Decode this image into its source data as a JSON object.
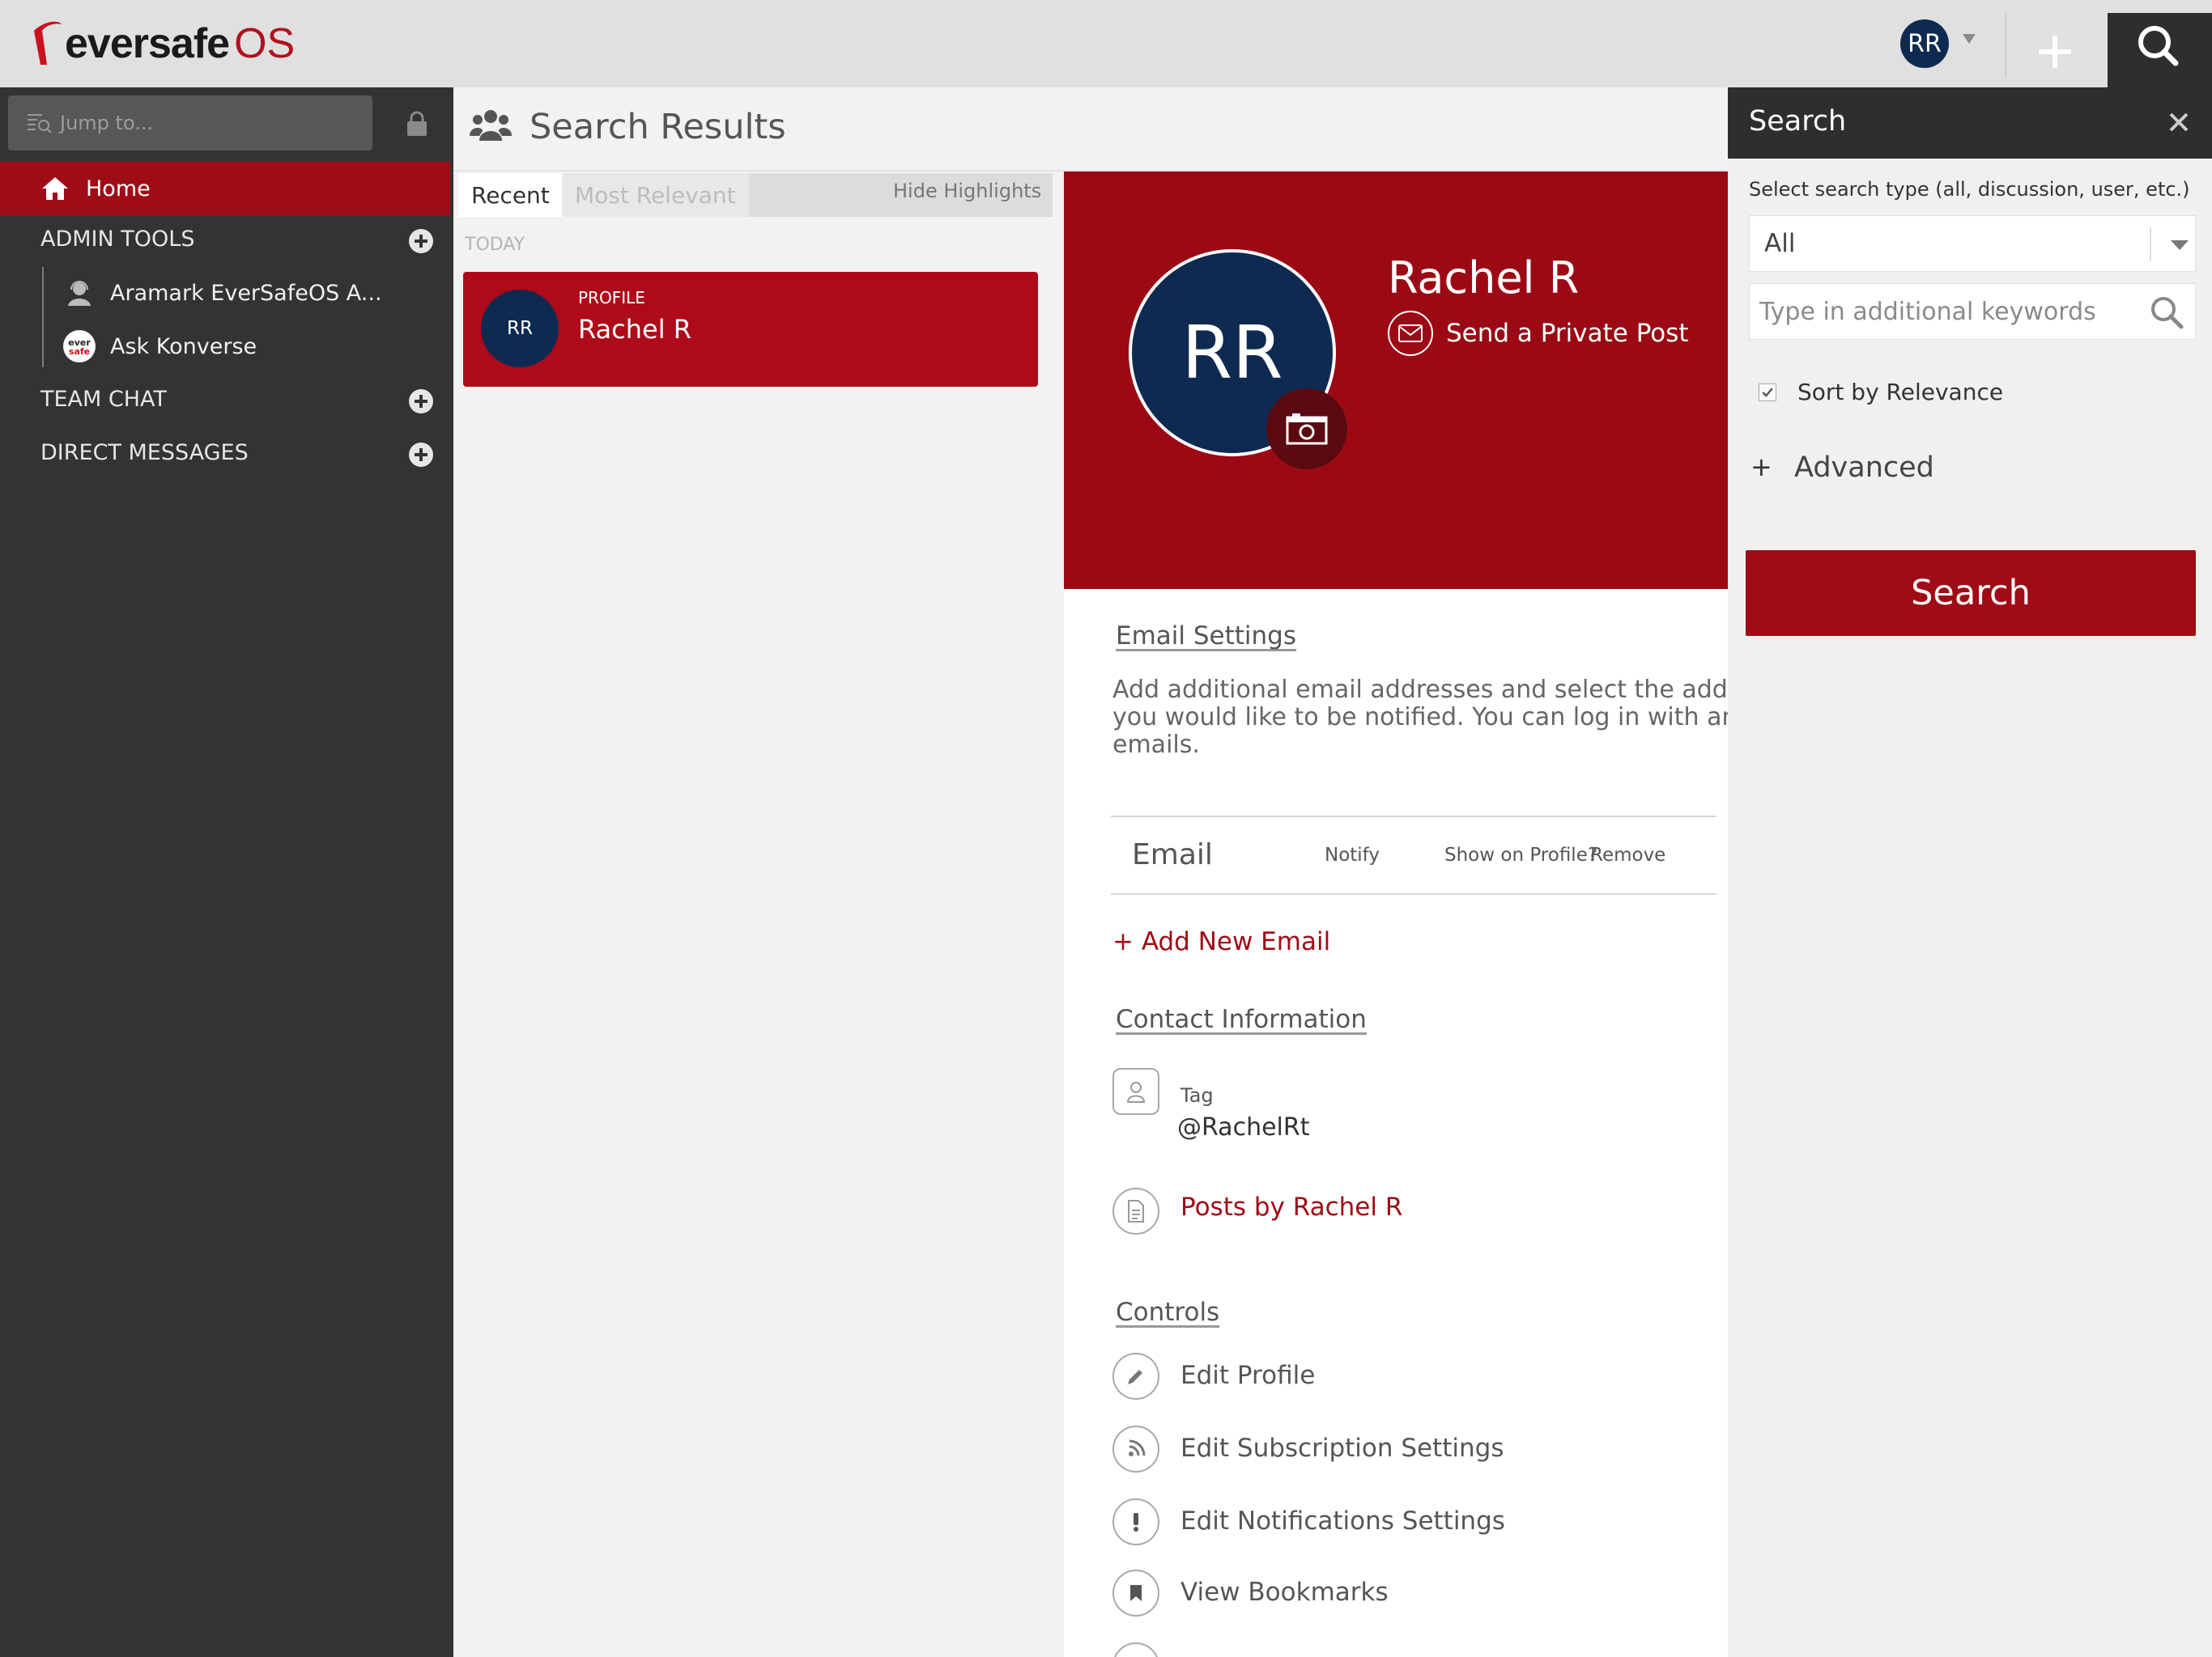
{
  "app": {
    "brand_name": "eversafe",
    "brand_suffix": "OS",
    "brand_color": "#b0111e"
  },
  "topbar": {
    "avatar_initials": "RR",
    "add_icon": "plus-icon",
    "search_icon": "search-icon"
  },
  "sidebar": {
    "jump_placeholder": "Jump to...",
    "home_label": "Home",
    "sections": [
      {
        "label": "ADMIN TOOLS",
        "items": [
          {
            "label": "Aramark EverSafeOS A...",
            "icon": "agent-icon"
          },
          {
            "label": "Ask Konverse",
            "icon": "eversafe-logo-icon"
          }
        ]
      },
      {
        "label": "TEAM CHAT",
        "items": []
      },
      {
        "label": "DIRECT MESSAGES",
        "items": []
      }
    ]
  },
  "results": {
    "title": "Search Results",
    "tabs": [
      {
        "label": "Recent",
        "active": true
      },
      {
        "label": "Most Relevant",
        "active": false
      }
    ],
    "hide_highlights": "Hide Highlights",
    "group_label": "TODAY",
    "items": [
      {
        "kind": "PROFILE",
        "initials": "RR",
        "name": "Rachel R"
      }
    ]
  },
  "profile": {
    "initials": "RR",
    "name": "Rachel R",
    "private_post_label": "Send a Private Post",
    "email_settings": {
      "title": "Email Settings",
      "description_lines": [
        "Add additional email addresses and select the address",
        "you would like to be notified. You can log in with any v",
        "emails."
      ],
      "columns": [
        "Email",
        "Notify",
        "Show on Profile?",
        "Remove"
      ],
      "add_label": "+ Add New Email"
    },
    "contact": {
      "title": "Contact Information",
      "tag_label": "Tag",
      "tag_value": "@RachelRt",
      "posts_link": "Posts by Rachel R"
    },
    "controls": {
      "title": "Controls",
      "items": [
        {
          "label": "Edit Profile",
          "icon": "pencil-icon"
        },
        {
          "label": "Edit Subscription Settings",
          "icon": "rss-icon"
        },
        {
          "label": "Edit Notifications Settings",
          "icon": "exclamation-icon"
        },
        {
          "label": "View Bookmarks",
          "icon": "bookmark-icon"
        }
      ]
    },
    "banner_color": "#9b0a14",
    "avatar_color": "#0e2a50"
  },
  "search_panel": {
    "title": "Search",
    "type_label": "Select search type (all, discussion, user, etc.)",
    "type_value": "All",
    "keywords_placeholder": "Type in additional keywords",
    "sort_label": "Sort by Relevance",
    "sort_checked": true,
    "advanced_plus": "+",
    "advanced_label": "Advanced",
    "search_button": "Search"
  }
}
